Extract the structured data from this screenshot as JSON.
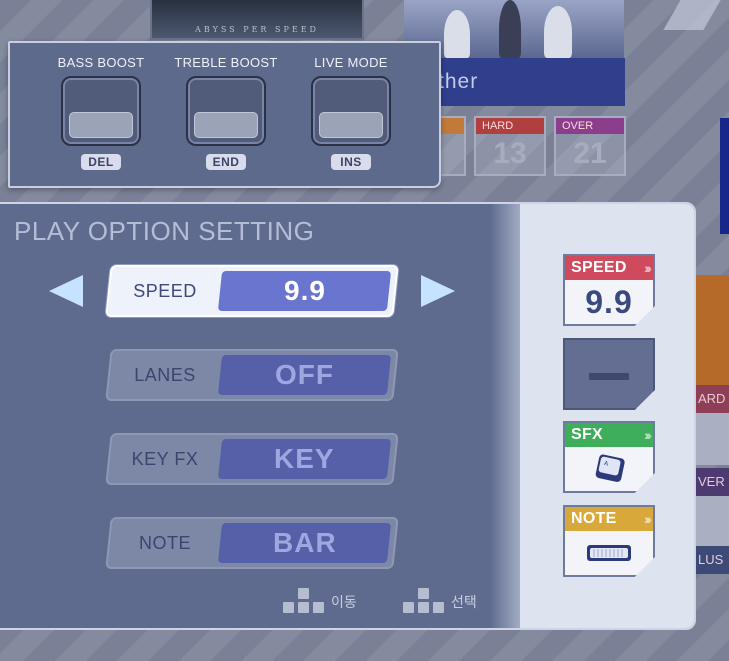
{
  "background": {
    "jacket_caption": "ABYSS PER SPEED",
    "song_title_fragment": "ther",
    "difficulties": [
      {
        "label": "HARD",
        "level": "13"
      },
      {
        "label": "OVER",
        "level": "21"
      }
    ],
    "right_edge_tags": [
      "ARD",
      "VER",
      "LUS"
    ]
  },
  "effects": {
    "items": [
      {
        "label": "BASS BOOST",
        "key": "DEL"
      },
      {
        "label": "TREBLE BOOST",
        "key": "END"
      },
      {
        "label": "LIVE MODE",
        "key": "INS"
      }
    ]
  },
  "play_options": {
    "title": "PLAY OPTION SETTING",
    "selected_index": 0,
    "rows": [
      {
        "label": "SPEED",
        "value": "9.9"
      },
      {
        "label": "LANES",
        "value": "OFF"
      },
      {
        "label": "KEY FX",
        "value": "KEY"
      },
      {
        "label": "NOTE",
        "value": "BAR"
      }
    ],
    "hints": {
      "move": "이동",
      "select": "선택"
    }
  },
  "status_cards": {
    "speed": {
      "label": "SPEED",
      "value": "9.9"
    },
    "sfx": {
      "label": "SFX",
      "icon": "keycap-icon"
    },
    "note": {
      "label": "NOTE",
      "icon": "bar-note-icon"
    }
  },
  "colors": {
    "speed_tag": "#d04a5e",
    "sfx_tag": "#3fae5a",
    "note_tag": "#d8a83a",
    "active_value": "#6a75d0",
    "arrow": "#c5e3ff"
  }
}
